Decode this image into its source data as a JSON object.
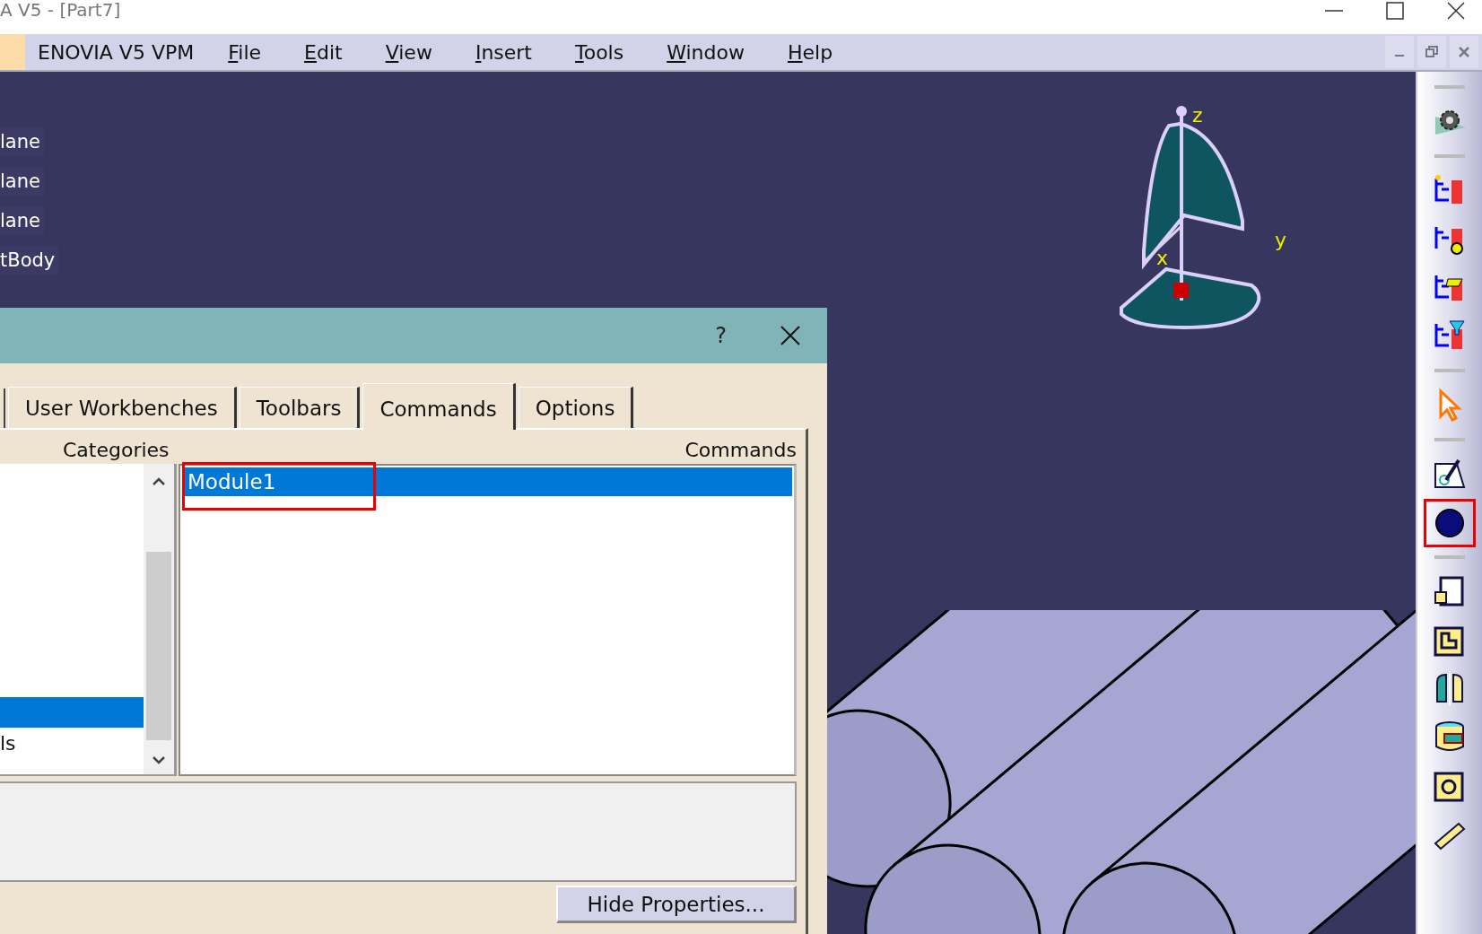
{
  "window": {
    "title": "A V5 - [Part7]"
  },
  "menu_bar": {
    "app_label": "ENOVIA V5 VPM",
    "menus": [
      "File",
      "Edit",
      "View",
      "Insert",
      "Tools",
      "Window",
      "Help"
    ]
  },
  "tree": [
    "lane",
    "lane",
    "lane",
    "tBody"
  ],
  "compass": {
    "axes": [
      "z",
      "y",
      "x"
    ]
  },
  "dialog": {
    "help": "?",
    "tabs": [
      {
        "label": "User Workbenches",
        "selected": false
      },
      {
        "label": "Toolbars",
        "selected": false
      },
      {
        "label": "Commands",
        "selected": true
      },
      {
        "label": "Options",
        "selected": false
      }
    ],
    "categories_label": "Categories",
    "commands_label": "Commands",
    "categories": [
      {
        "selected": true
      },
      {
        "label": "ls",
        "selected": false
      }
    ],
    "commands": [
      {
        "label": "Module1",
        "selected": true,
        "highlighted": true
      }
    ],
    "button": "Hide Properties..."
  },
  "toolbar_tools": [
    {
      "highlighted": false
    },
    {
      "highlighted": false
    },
    {
      "highlighted": false
    },
    {
      "highlighted": false
    },
    {
      "highlighted": false
    },
    {
      "highlighted": false
    },
    {
      "highlighted": false
    },
    {
      "highlighted": true
    },
    {
      "highlighted": false
    },
    {
      "highlighted": false
    },
    {
      "highlighted": false
    },
    {
      "highlighted": false
    },
    {
      "highlighted": false
    },
    {
      "highlighted": false
    }
  ]
}
